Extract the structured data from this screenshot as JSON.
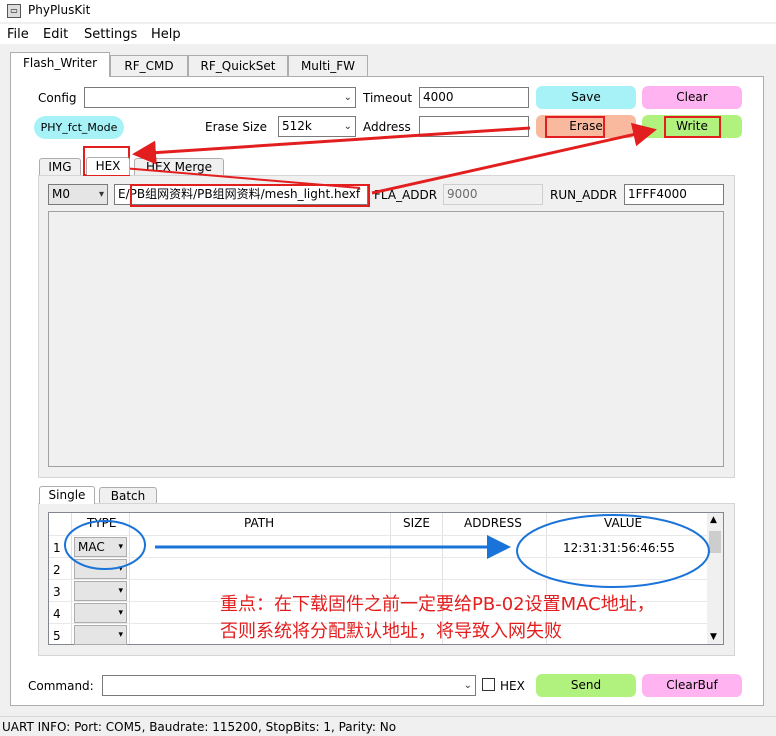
{
  "window": {
    "title": "PhyPlusKit",
    "icon": "app-icon"
  },
  "menu": [
    "File",
    "Edit",
    "Settings",
    "Help"
  ],
  "main_tabs": [
    "Flash_Writer",
    "RF_CMD",
    "RF_QuickSet",
    "Multi_FW"
  ],
  "config": {
    "config_label": "Config",
    "config_value": "",
    "timeout_label": "Timeout",
    "timeout_value": "4000",
    "save": "Save",
    "clear": "Clear",
    "mode": "PHY_fct_Mode",
    "erase_size_label": "Erase Size",
    "erase_size_value": "512k",
    "address_label": "Address",
    "address_value": "",
    "erase": "Erase",
    "write": "Write"
  },
  "sub_tabs": [
    "IMG",
    "HEX",
    "HEX Merge"
  ],
  "hex": {
    "core_value": "M0",
    "path_value": "E/PB组网资料/PB组网资料/mesh_light.hexf",
    "fla_addr_label": "FLA_ADDR",
    "fla_addr_value": "9000",
    "run_addr_label": "RUN_ADDR",
    "run_addr_value": "1FFF4000"
  },
  "bottom_tabs": [
    "Single",
    "Batch"
  ],
  "table": {
    "headers": [
      "TYPE",
      "PATH",
      "SIZE",
      "ADDRESS",
      "VALUE"
    ],
    "rows": [
      {
        "num": "1",
        "type": "MAC",
        "path": "",
        "size": "",
        "address": "",
        "value": "12:31:31:56:46:55"
      },
      {
        "num": "2",
        "type": "",
        "path": "",
        "size": "",
        "address": "",
        "value": ""
      },
      {
        "num": "3",
        "type": "",
        "path": "",
        "size": "",
        "address": "",
        "value": ""
      },
      {
        "num": "4",
        "type": "",
        "path": "",
        "size": "",
        "address": "",
        "value": ""
      },
      {
        "num": "5",
        "type": "",
        "path": "",
        "size": "",
        "address": "",
        "value": ""
      }
    ]
  },
  "annotation": {
    "line1": "重点：在下载固件之前一定要给PB-02设置MAC地址，",
    "line2": "否则系统将分配默认地址，将导致入网失败",
    "color": "#e31e1e"
  },
  "command": {
    "label": "Command:",
    "value": "",
    "hex_label": "HEX",
    "hex_checked": false,
    "send": "Send",
    "clearbuf": "ClearBuf"
  },
  "status": {
    "text": "UART INFO:  Port: COM5, Baudrate: 115200, StopBits: 1, Parity: No"
  }
}
